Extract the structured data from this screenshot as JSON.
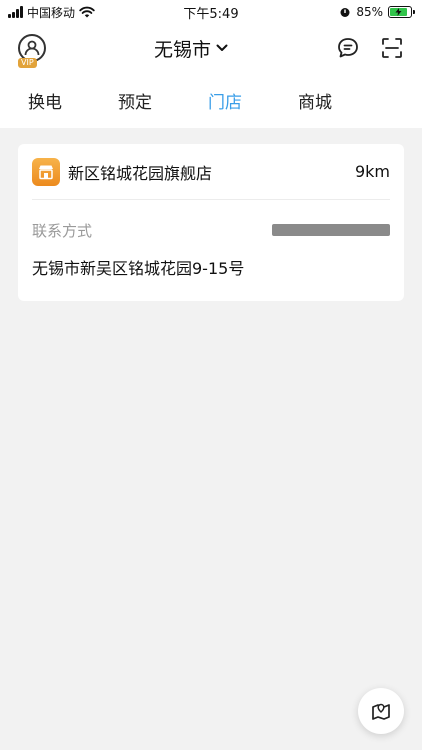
{
  "status_bar": {
    "carrier": "中国移动",
    "time": "下午5:49",
    "battery_percent": "85%",
    "battery_level": 0.85
  },
  "header": {
    "city": "无锡市",
    "vip_label": "VIP",
    "icons": [
      "avatar-icon",
      "chevron-down-icon",
      "message-icon",
      "scan-icon"
    ]
  },
  "tabs": [
    {
      "label": "换电",
      "active": false
    },
    {
      "label": "预定",
      "active": false
    },
    {
      "label": "门店",
      "active": true
    },
    {
      "label": "商城",
      "active": false
    }
  ],
  "store": {
    "name": "新区铭城花园旗舰店",
    "distance": "9km",
    "contact_label": "联系方式",
    "address": "无锡市新吴区铭城花园9-15号"
  },
  "colors": {
    "accent": "#3a9ee8",
    "store_icon": "#f0982a",
    "vip": "#e2a33a",
    "battery": "#31c44a"
  }
}
